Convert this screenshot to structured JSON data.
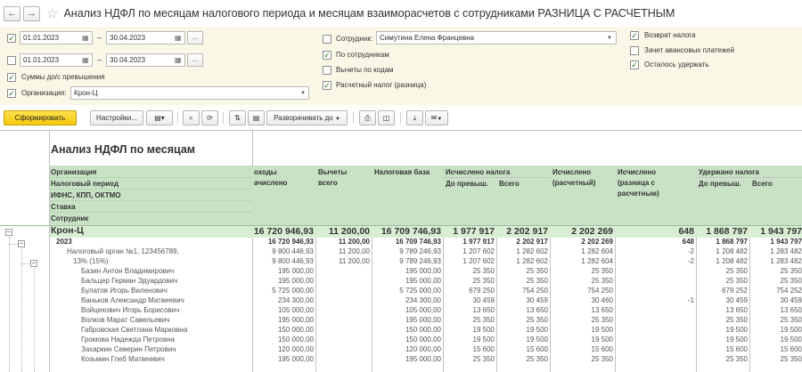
{
  "window": {
    "title": "Анализ НДФЛ по месяцам налогового периода и месяцам взаиморасчетов с сотрудниками РАЗНИЦА С РАСЧЕТНЫМ",
    "back_icon": "arrow-left-icon",
    "forward_icon": "arrow-right-icon",
    "favorite_icon": "star-icon"
  },
  "filters": {
    "period1": {
      "checked": true,
      "from": "01.01.2023",
      "to": "30.04.2023",
      "ellipsis": "..."
    },
    "period2": {
      "checked": false,
      "from": "01.01.2023",
      "to": "30.04.2023",
      "ellipsis": "..."
    },
    "sums_before_exceed": {
      "checked": true,
      "label": "Суммы до/с превышения"
    },
    "organization": {
      "checked": true,
      "label": "Организация:",
      "value": "Крон-Ц"
    },
    "employee": {
      "checked": false,
      "label": "Сотрудник:",
      "value": "Симутина Елена Францевна"
    },
    "by_employees": {
      "checked": true,
      "label": "По сотрудникам"
    },
    "deductions_by_codes": {
      "checked": false,
      "label": "Вычеты по кодам"
    },
    "calc_tax_diff": {
      "checked": true,
      "label": "Расчетный налог (разница)"
    },
    "tax_refund": {
      "checked": true,
      "label": "Возврат налога"
    },
    "advance_offset": {
      "checked": false,
      "label": "Зачет авансовых платежей"
    },
    "remaining_withhold": {
      "checked": true,
      "label": "Осталось удержать"
    }
  },
  "toolbar": {
    "generate": "Сформировать",
    "settings": "Настройки...",
    "expand_to": "Разворачивать до",
    "icons": [
      "variants-icon",
      "search-icon",
      "search-clear-icon",
      "sort-asc-icon",
      "sort-desc-icon",
      "print-icon",
      "preview-icon",
      "save-icon",
      "mail-icon"
    ]
  },
  "report": {
    "title": "Анализ НДФЛ по месяцам",
    "row_headers": [
      "Организация",
      "Налоговый период",
      "ИФНС, КПП, ОКТМО",
      "Ставка",
      "Сотрудник"
    ],
    "columns": [
      {
        "line1": "оходы",
        "line2": "ачислено"
      },
      {
        "line1": "Вычеты",
        "line2": "всего"
      },
      {
        "line1": "Налоговая база",
        "line2": ""
      },
      {
        "line1": "Исчислено налога",
        "sub1": "До превыш.",
        "sub2": "Всего"
      },
      {
        "line1": "Исчислено",
        "line2": "(расчетный)"
      },
      {
        "line1": "Исчислено",
        "line2": "(разница с",
        "line3": "расчетным)"
      },
      {
        "line1": "Удержано налога",
        "sub1": "До превыш.",
        "sub2": "Всего"
      }
    ],
    "org_row": {
      "name": "Крон-Ц",
      "values": [
        "16 720 946,93",
        "11 200,00",
        "16 709 746,93",
        "1 977 917",
        "2 202 917",
        "2 202 269",
        "648",
        "1 868 797",
        "1 943 797"
      ]
    },
    "rows": [
      {
        "name": "2023",
        "bold": true,
        "values": [
          "16 720 946,93",
          "11 200,00",
          "16 709 746,93",
          "1 977 917",
          "2 202 917",
          "2 202 269",
          "648",
          "1 868 797",
          "1 943 797"
        ]
      },
      {
        "name": "Налоговый орган №1, 123456789,",
        "bold": false,
        "values": [
          "9 800 446,93",
          "11 200,00",
          "9 789 246,93",
          "1 207 602",
          "1 282 602",
          "1 282 604",
          "-2",
          "1 208 482",
          "1 283 482"
        ]
      },
      {
        "name": "13% (15%)",
        "bold": false,
        "values": [
          "9 800 446,93",
          "11 200,00",
          "9 789 246,93",
          "1 207 602",
          "1 282 602",
          "1 282 604",
          "-2",
          "1 208 482",
          "1 283 482"
        ]
      },
      {
        "name": "Базин Антон Владимирович",
        "bold": false,
        "values": [
          "195 000,00",
          "",
          "195 000,00",
          "25 350",
          "25 350",
          "25 350",
          "",
          "25 350",
          "25 350"
        ]
      },
      {
        "name": "Бальцер Герман Эдуардович",
        "bold": false,
        "values": [
          "195 000,00",
          "",
          "195 000,00",
          "25 350",
          "25 350",
          "25 350",
          "",
          "25 350",
          "25 350"
        ]
      },
      {
        "name": "Булатов Игорь Виленович",
        "bold": false,
        "values": [
          "5 725 000,00",
          "",
          "5 725 000,00",
          "679 250",
          "754 250",
          "754 250",
          "",
          "679 252",
          "754 252"
        ]
      },
      {
        "name": "Ваньков Александр Матвеевич",
        "bold": false,
        "values": [
          "234 300,00",
          "",
          "234 300,00",
          "30 459",
          "30 459",
          "30 460",
          "-1",
          "30 459",
          "30 459"
        ]
      },
      {
        "name": "Войцехович Игорь Борисович",
        "bold": false,
        "values": [
          "105 000,00",
          "",
          "105 000,00",
          "13 650",
          "13 650",
          "13 650",
          "",
          "13 650",
          "13 650"
        ]
      },
      {
        "name": "Волков Марат Савельевич",
        "bold": false,
        "values": [
          "195 000,00",
          "",
          "195 000,00",
          "25 350",
          "25 350",
          "25 350",
          "",
          "25 350",
          "25 350"
        ]
      },
      {
        "name": "Габровская Светлана Марковна",
        "bold": false,
        "values": [
          "150 000,00",
          "",
          "150 000,00",
          "19 500",
          "19 500",
          "19 500",
          "",
          "19 500",
          "19 500"
        ]
      },
      {
        "name": "Громова Надежда Петровна",
        "bold": false,
        "values": [
          "150 000,00",
          "",
          "150 000,00",
          "19 500",
          "19 500",
          "19 500",
          "",
          "19 500",
          "19 500"
        ]
      },
      {
        "name": "Захаркин Северин Петрович",
        "bold": false,
        "values": [
          "120 000,00",
          "",
          "120 000,00",
          "15 600",
          "15 600",
          "15 600",
          "",
          "15 600",
          "15 600"
        ]
      },
      {
        "name": "Козьмин Глеб Матвеевич",
        "bold": false,
        "values": [
          "195 000,00",
          "",
          "195 000,00",
          "25 350",
          "25 350",
          "25 350",
          "",
          "25 350",
          "25 350"
        ]
      }
    ]
  }
}
